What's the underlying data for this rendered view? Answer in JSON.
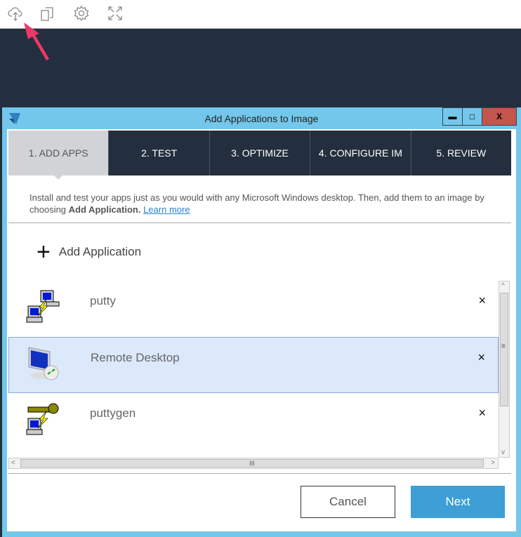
{
  "toolbar": {
    "icons": [
      "cloud-upload-icon",
      "switch-window-icon",
      "settings-gear-icon",
      "fullscreen-icon"
    ]
  },
  "window": {
    "title": "Add Applications to Image",
    "minimize": "▬",
    "maximize": "□",
    "close": "X",
    "tabs": [
      {
        "label": "1. ADD APPS"
      },
      {
        "label": "2. TEST"
      },
      {
        "label": "3. OPTIMIZE"
      },
      {
        "label": "4. CONFIGURE IM"
      },
      {
        "label": "5. REVIEW"
      }
    ],
    "description": {
      "text": "Install and test your apps just as you would with any Microsoft Windows desktop. Then, add them to an image by choosing ",
      "bold": "Add Application.",
      "link": "Learn more"
    },
    "add_application": {
      "icon": "+",
      "label": "Add Application"
    },
    "apps": [
      {
        "name": "putty",
        "remove": "×"
      },
      {
        "name": "Remote Desktop",
        "remove": "×"
      },
      {
        "name": "puttygen",
        "remove": "×"
      }
    ],
    "scroll_thumb_grip": "≡",
    "hscroll_grip": "III",
    "cancel_label": "Cancel",
    "next_label": "Next"
  }
}
